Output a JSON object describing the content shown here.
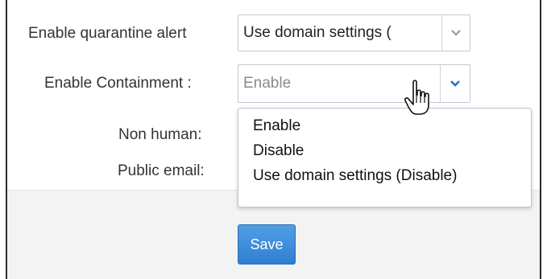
{
  "form": {
    "quarantine_alert": {
      "label": "Enable quarantine alert",
      "value": "Use domain settings ("
    },
    "containment": {
      "label": "Enable Containment :",
      "value": "Enable",
      "options": [
        "Enable",
        "Disable",
        "Use domain settings (Disable)"
      ]
    },
    "non_human": {
      "label": "Non human:"
    },
    "public_email": {
      "label": "Public email:"
    }
  },
  "actions": {
    "save_label": "Save"
  },
  "colors": {
    "accent_blue": "#2f7fd0",
    "chevron_blue": "#1f78c8",
    "chevron_grey": "#9a9a9a",
    "text": "#333333",
    "placeholder": "#8a8a8a"
  },
  "icons": {
    "dropdown_arrow": "chevron-down-icon",
    "cursor": "hand-pointer-icon"
  }
}
